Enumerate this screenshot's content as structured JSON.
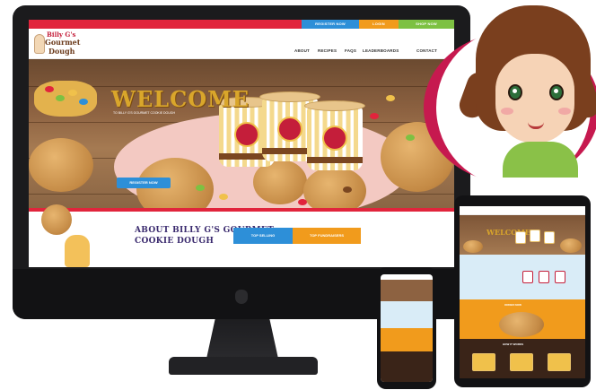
{
  "site": {
    "topbar": {
      "register": "REGISTER NOW",
      "login": "LOGIN",
      "shop": "SHOP NOW"
    },
    "logo": {
      "line1": "Billy G's",
      "line2": "Gourmet",
      "line3": "Dough"
    },
    "nav": [
      "ABOUT",
      "RECIPES",
      "FAQS",
      "LEADERBOARDS",
      "CONTACT"
    ],
    "hero": {
      "title": "WELCOME",
      "subtitle": "TO BILLY G'S GOURMET COOKIE DOUGH",
      "button": "REGISTER NOW"
    },
    "about": {
      "title_line1": "ABOUT BILLY G'S GOURMET",
      "title_line2": "COOKIE DOUGH",
      "tab_best": "TOP SELLING",
      "tab_fav": "TOP FUNDRAISERS"
    }
  },
  "tablet": {
    "welcome": "WELCOME",
    "orange_text": "ORDER NOW",
    "dark_text": "HOW IT WORKS"
  },
  "colors": {
    "red": "#e1243c",
    "blue": "#2d8fd8",
    "orange": "#f19b1c",
    "green": "#7dc142",
    "avatar_bg": "#c6194f",
    "hair": "#7a3f1e"
  }
}
